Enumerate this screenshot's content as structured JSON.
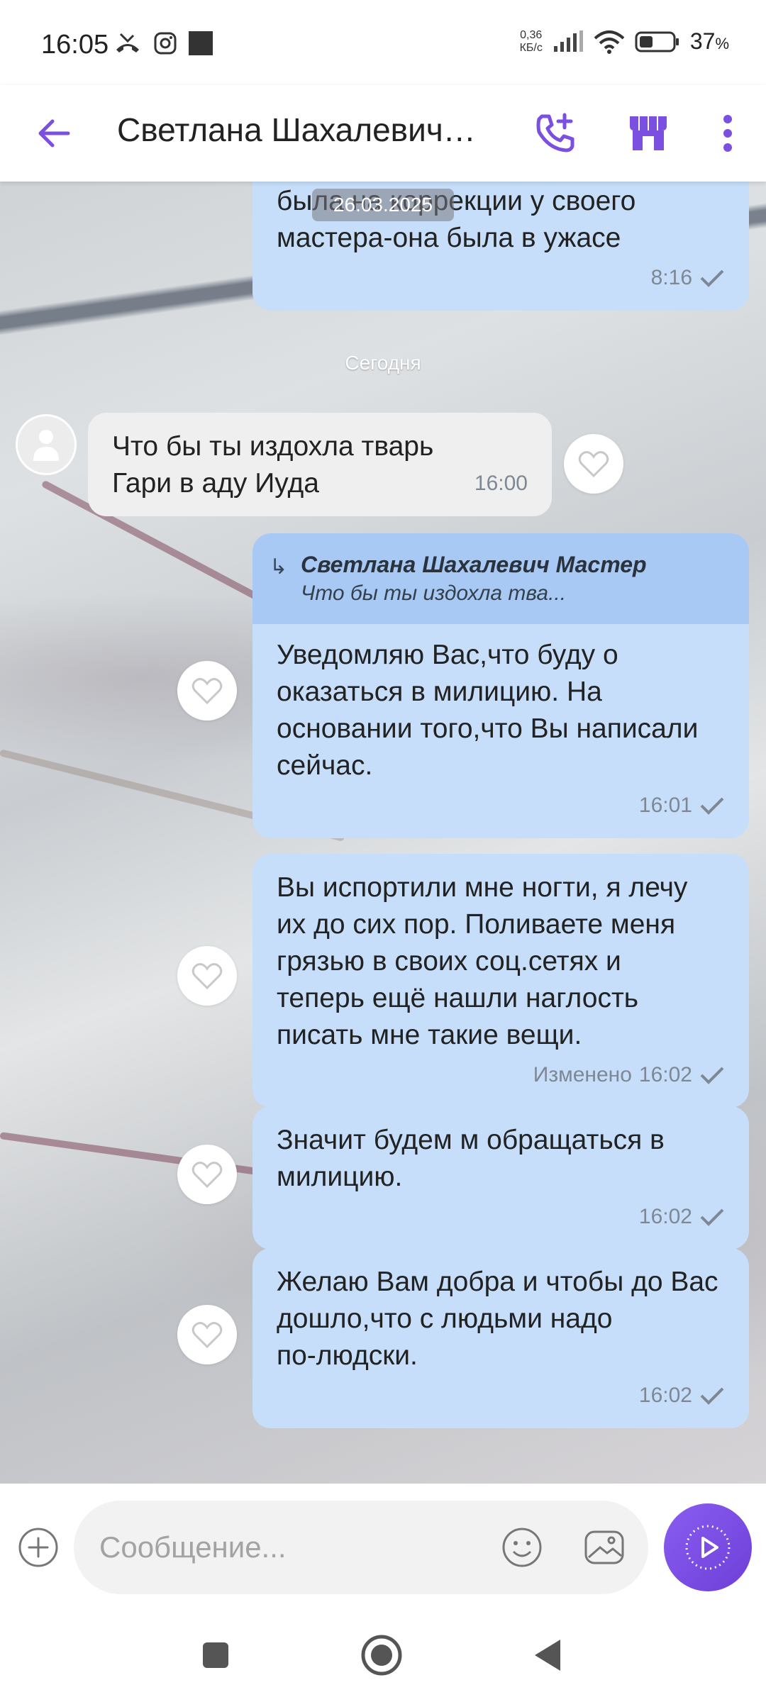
{
  "status_bar": {
    "time": "16:05",
    "net_speed_value": "0,36",
    "net_speed_unit": "КБ/с",
    "battery": "37",
    "battery_unit": "%"
  },
  "header": {
    "title": "Светлана Шахалевич…",
    "accent_color": "#7b4fe0"
  },
  "chat": {
    "date_pill": "26.03.2025",
    "prev_message": {
      "text": "была на коррекции у своего\nмастера-она была в ужасе",
      "time": "8:16"
    },
    "today_label": "Сегодня",
    "incoming": {
      "text": "Что бы ты издохла тварь\nГари в аду Иуда",
      "time": "16:00"
    },
    "reply": {
      "quoted_name": "Светлана Шахалевич Мастер",
      "quoted_text": "Что бы ты издохла тва...",
      "text": "Уведомляю Вас,что буду о\nоказаться в милицию. На\nосновании того,что Вы написали\nсейчас.",
      "time": "16:01"
    },
    "msg2": {
      "text": "Вы испортили мне ногти, я лечу\nих до сих пор. Поливаете меня\nгрязью в своих соц.сетях и\nтеперь ещё нашли наглость\nписать мне такие вещи.",
      "edited": "Изменено",
      "time": "16:02"
    },
    "msg3": {
      "text": "Значит будем м обращаться в\nмилицию.",
      "time": "16:02"
    },
    "msg4": {
      "text": "Желаю Вам добра и чтобы до Вас\nдошло,что с людьми надо\nпо-людски.",
      "time": "16:02"
    }
  },
  "input": {
    "placeholder": "Сообщение..."
  },
  "icons": {
    "back": "arrow-left-icon",
    "call": "phone-plus-icon",
    "shop": "store-icon",
    "more": "more-vertical-icon",
    "like": "heart-icon",
    "send": "send-icon",
    "emoji": "smiley-icon",
    "gallery": "gallery-icon"
  }
}
